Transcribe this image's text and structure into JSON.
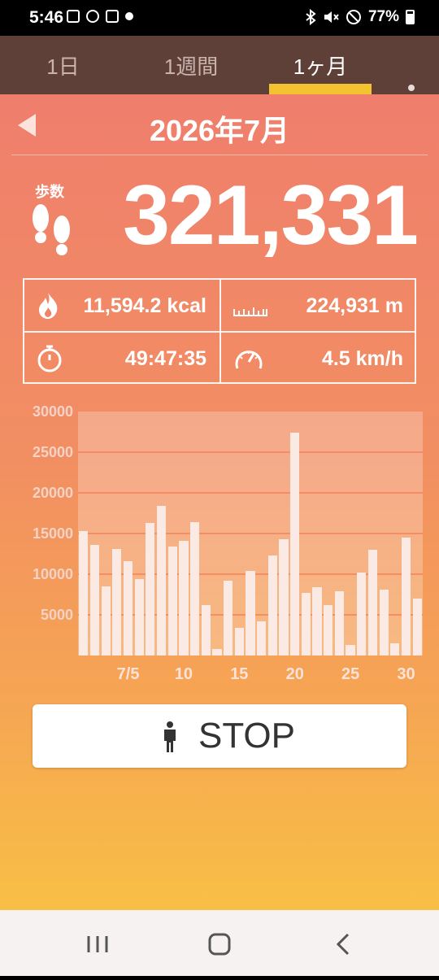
{
  "status_bar": {
    "time": "5:46",
    "battery": "77%",
    "left_icons": [
      "gallery-icon",
      "percent-icon",
      "data-saver-icon",
      "dot-icon"
    ],
    "right_icons": [
      "bluetooth-icon",
      "mute-icon",
      "dnd-icon",
      "battery-icon"
    ]
  },
  "tabs": [
    {
      "label": "1日",
      "active": false
    },
    {
      "label": "1週間",
      "active": false
    },
    {
      "label": "1ヶ月",
      "active": true
    }
  ],
  "header": {
    "month": "2026年7月"
  },
  "steps": {
    "label": "歩数",
    "value": "321,331"
  },
  "stats": {
    "calories": "11,594.2 kcal",
    "distance": "224,931 m",
    "time": "49:47:35",
    "speed": "4.5 km/h"
  },
  "chart_data": {
    "type": "bar",
    "x": [
      1,
      2,
      3,
      4,
      5,
      6,
      7,
      8,
      9,
      10,
      11,
      12,
      13,
      14,
      15,
      16,
      17,
      18,
      19,
      20,
      21,
      22,
      23,
      24,
      25,
      26,
      27,
      28,
      29,
      30,
      31
    ],
    "values": [
      15300,
      13600,
      8500,
      13100,
      11600,
      9400,
      16300,
      18400,
      13400,
      14100,
      16400,
      6200,
      800,
      9200,
      3400,
      10400,
      4200,
      12300,
      14300,
      27400,
      7700,
      8400,
      6200,
      7900,
      1300,
      10200,
      13000,
      8100,
      1500,
      14500,
      7000
    ],
    "x_ticks": [
      "7/5",
      "10",
      "15",
      "20",
      "25",
      "30"
    ],
    "y_ticks": [
      "5000",
      "10000",
      "15000",
      "20000",
      "25000",
      "30000"
    ],
    "ylim": [
      0,
      30000
    ],
    "grid": true,
    "bar_color": "#fbeae3"
  },
  "stop_button": {
    "label": "STOP"
  },
  "colors": {
    "tab_bar": "#5f4039",
    "tab_indicator": "#f3c330",
    "gradient_top": "#ef7e6c",
    "gradient_bottom": "#f8bf45"
  }
}
